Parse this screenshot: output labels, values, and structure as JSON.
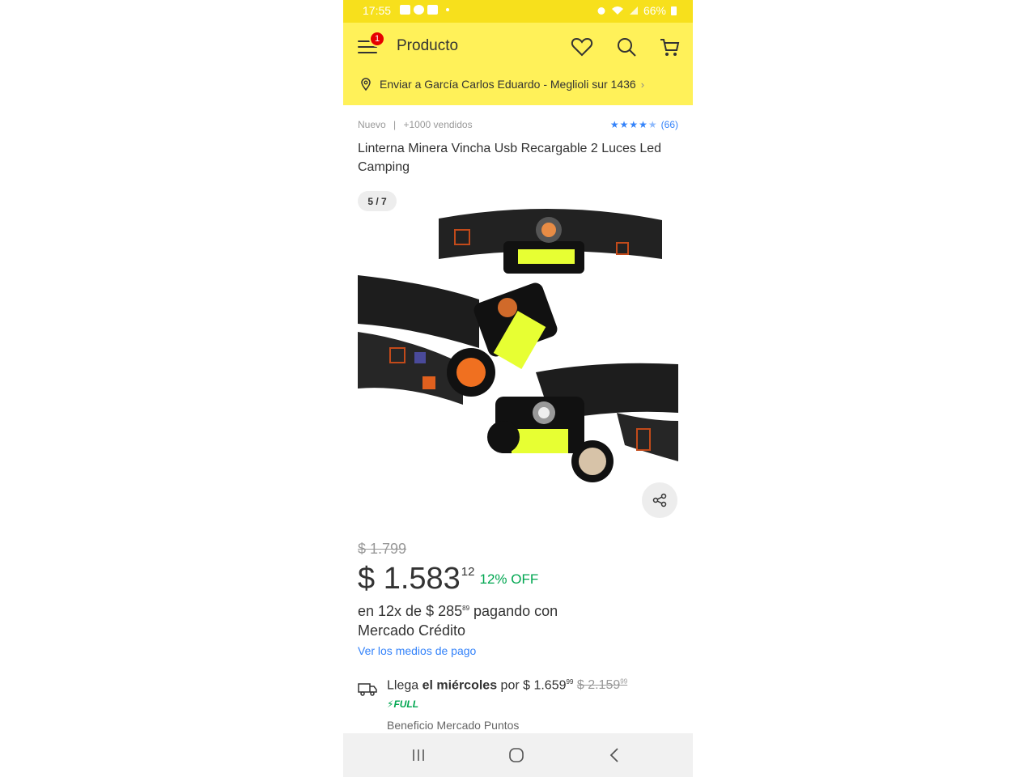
{
  "status_bar": {
    "time": "17:55",
    "battery": "66%"
  },
  "header": {
    "title": "Producto",
    "menu_badge": "1",
    "delivery": "Enviar a García Carlos Eduardo - Meglioli sur 1436"
  },
  "product": {
    "condition": "Nuevo",
    "separator": "|",
    "sold": "+1000 vendidos",
    "rating_count": "(66)",
    "rating_stars": 4.5,
    "title": "Linterna Minera Vincha Usb Recargable 2 Luces Led Camping",
    "image_counter": "5 / 7"
  },
  "price": {
    "original": "$ 1.799",
    "current": "$ 1.583",
    "cents": "12",
    "discount": "12% OFF",
    "installments_prefix": "en 12x de $ 285",
    "installments_cents": "89",
    "installments_suffix": " pagando con Mercado Crédito",
    "payment_link": "Ver los medios de pago"
  },
  "shipping": {
    "prefix": "Llega ",
    "day": "el miércoles",
    "by": " por ",
    "price": "$ 1.659",
    "price_cents": "99",
    "old_price": "$ 2.159",
    "old_price_cents": "99",
    "badge": "FULL",
    "points": "Beneficio Mercado Puntos"
  },
  "colors": {
    "header_bg": "#fff159",
    "accent_blue": "#3483fa",
    "discount_green": "#00a650",
    "badge_red": "#e60000"
  }
}
